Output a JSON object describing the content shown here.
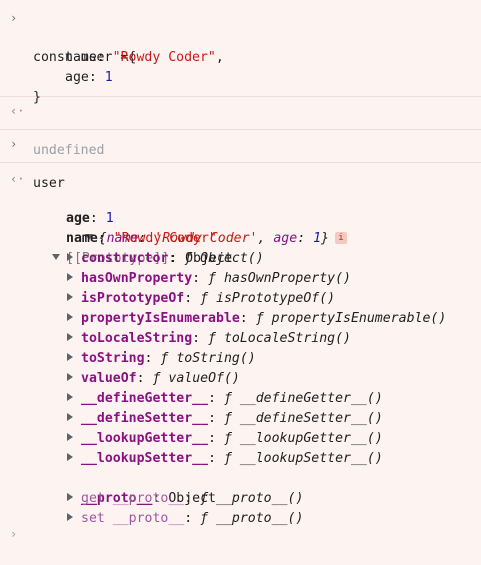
{
  "input1": {
    "line1": "const user ={",
    "line2_key": "name: ",
    "line2_val": "\"Rowdy Coder\"",
    "line2_end": ",",
    "line3_key": "age: ",
    "line3_val": "1",
    "line4": "}"
  },
  "result1": "undefined",
  "input2": "user",
  "result2": {
    "preview_open": "{",
    "preview_name_key": "name",
    "preview_name_val": "'Rowdy Coder'",
    "preview_age_key": "age",
    "preview_age_val": "1",
    "preview_close": "}",
    "info_badge": "i",
    "age_key": "age",
    "age_val": "1",
    "name_key": "name",
    "name_val": "\"Rowdy Coder\"",
    "proto_key": "[[Prototype]]",
    "proto_val": "Object"
  },
  "proto_members": [
    {
      "key": "constructor",
      "fn": "Object()"
    },
    {
      "key": "hasOwnProperty",
      "fn": "hasOwnProperty()"
    },
    {
      "key": "isPrototypeOf",
      "fn": "isPrototypeOf()"
    },
    {
      "key": "propertyIsEnumerable",
      "fn": "propertyIsEnumerable()"
    },
    {
      "key": "toLocaleString",
      "fn": "toLocaleString()"
    },
    {
      "key": "toString",
      "fn": "toString()"
    },
    {
      "key": "valueOf",
      "fn": "valueOf()"
    },
    {
      "key": "__defineGetter__",
      "fn": "__defineGetter__()"
    },
    {
      "key": "__defineSetter__",
      "fn": "__defineSetter__()"
    },
    {
      "key": "__lookupGetter__",
      "fn": "__lookupGetter__()"
    },
    {
      "key": "__lookupSetter__",
      "fn": "__lookupSetter__()"
    }
  ],
  "proto_proto": {
    "key": "__proto__",
    "val": "Object"
  },
  "accessors": [
    {
      "prefix": "get",
      "key": "__proto__",
      "fn": "__proto__()"
    },
    {
      "prefix": "set",
      "key": "__proto__",
      "fn": "__proto__()"
    }
  ],
  "icons": {
    "prompt": "chevron-right-icon",
    "result": "return-arrow-icon",
    "fn_symbol": "ƒ"
  }
}
